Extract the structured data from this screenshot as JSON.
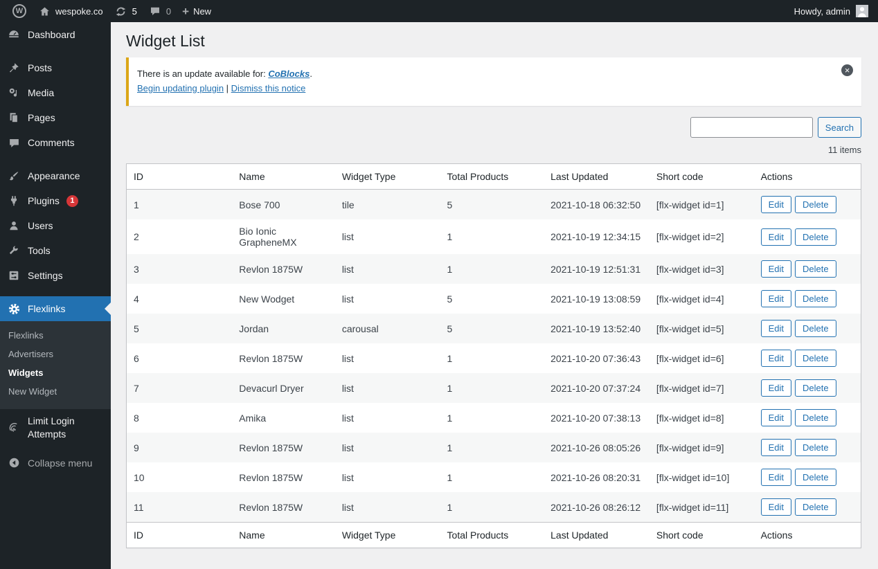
{
  "admin_bar": {
    "site_name": "wespoke.co",
    "updates_count": "5",
    "comments_count": "0",
    "new_label": "New",
    "howdy": "Howdy, admin"
  },
  "icons": {
    "wp_logo": "W",
    "plus": "+",
    "close": "×"
  },
  "sidebar": {
    "items": [
      {
        "label": "Dashboard"
      },
      {
        "label": "Posts"
      },
      {
        "label": "Media"
      },
      {
        "label": "Pages"
      },
      {
        "label": "Comments"
      },
      {
        "label": "Appearance"
      },
      {
        "label": "Plugins"
      },
      {
        "label": "Users"
      },
      {
        "label": "Tools"
      },
      {
        "label": "Settings"
      },
      {
        "label": "Flexlinks"
      }
    ],
    "plugins_badge": "1",
    "submenu": [
      {
        "label": "Flexlinks"
      },
      {
        "label": "Advertisers"
      },
      {
        "label": "Widgets"
      },
      {
        "label": "New Widget"
      }
    ],
    "limit_login_label": "Limit Login Attempts",
    "collapse_label": "Collapse menu"
  },
  "page": {
    "title": "Widget List",
    "notice": {
      "text_before": "There is an update available for: ",
      "link_label": "CoBlocks",
      "text_after": ".",
      "action1": "Begin updating plugin",
      "separator": " | ",
      "action2": "Dismiss this notice"
    },
    "search_button": "Search",
    "items_count": "11 items"
  },
  "table": {
    "headers": [
      "ID",
      "Name",
      "Widget Type",
      "Total Products",
      "Last Updated",
      "Short code",
      "Actions"
    ],
    "edit_label": "Edit",
    "delete_label": "Delete",
    "rows": [
      {
        "id": "1",
        "name": "Bose 700",
        "type": "tile",
        "total": "5",
        "updated": "2021-10-18 06:32:50",
        "shortcode": "[flx-widget id=1]"
      },
      {
        "id": "2",
        "name": "Bio Ionic GrapheneMX",
        "type": "list",
        "total": "1",
        "updated": "2021-10-19 12:34:15",
        "shortcode": "[flx-widget id=2]"
      },
      {
        "id": "3",
        "name": "Revlon 1875W",
        "type": "list",
        "total": "1",
        "updated": "2021-10-19 12:51:31",
        "shortcode": "[flx-widget id=3]"
      },
      {
        "id": "4",
        "name": "New Wodget",
        "type": "list",
        "total": "5",
        "updated": "2021-10-19 13:08:59",
        "shortcode": "[flx-widget id=4]"
      },
      {
        "id": "5",
        "name": "Jordan",
        "type": "carousal",
        "total": "5",
        "updated": "2021-10-19 13:52:40",
        "shortcode": "[flx-widget id=5]"
      },
      {
        "id": "6",
        "name": "Revlon 1875W",
        "type": "list",
        "total": "1",
        "updated": "2021-10-20 07:36:43",
        "shortcode": "[flx-widget id=6]"
      },
      {
        "id": "7",
        "name": "Devacurl Dryer",
        "type": "list",
        "total": "1",
        "updated": "2021-10-20 07:37:24",
        "shortcode": "[flx-widget id=7]"
      },
      {
        "id": "8",
        "name": "Amika",
        "type": "list",
        "total": "1",
        "updated": "2021-10-20 07:38:13",
        "shortcode": "[flx-widget id=8]"
      },
      {
        "id": "9",
        "name": "Revlon 1875W",
        "type": "list",
        "total": "1",
        "updated": "2021-10-26 08:05:26",
        "shortcode": "[flx-widget id=9]"
      },
      {
        "id": "10",
        "name": "Revlon 1875W",
        "type": "list",
        "total": "1",
        "updated": "2021-10-26 08:20:31",
        "shortcode": "[flx-widget id=10]"
      },
      {
        "id": "11",
        "name": "Revlon 1875W",
        "type": "list",
        "total": "1",
        "updated": "2021-10-26 08:26:12",
        "shortcode": "[flx-widget id=11]"
      }
    ]
  },
  "colors": {
    "accent_blue": "#2271b1",
    "notice_border": "#dba617",
    "badge_red": "#d63638",
    "admin_dark": "#1d2327",
    "submenu_dark": "#2c3338",
    "content_bg": "#f0f0f1",
    "stripe": "#f6f7f7"
  }
}
